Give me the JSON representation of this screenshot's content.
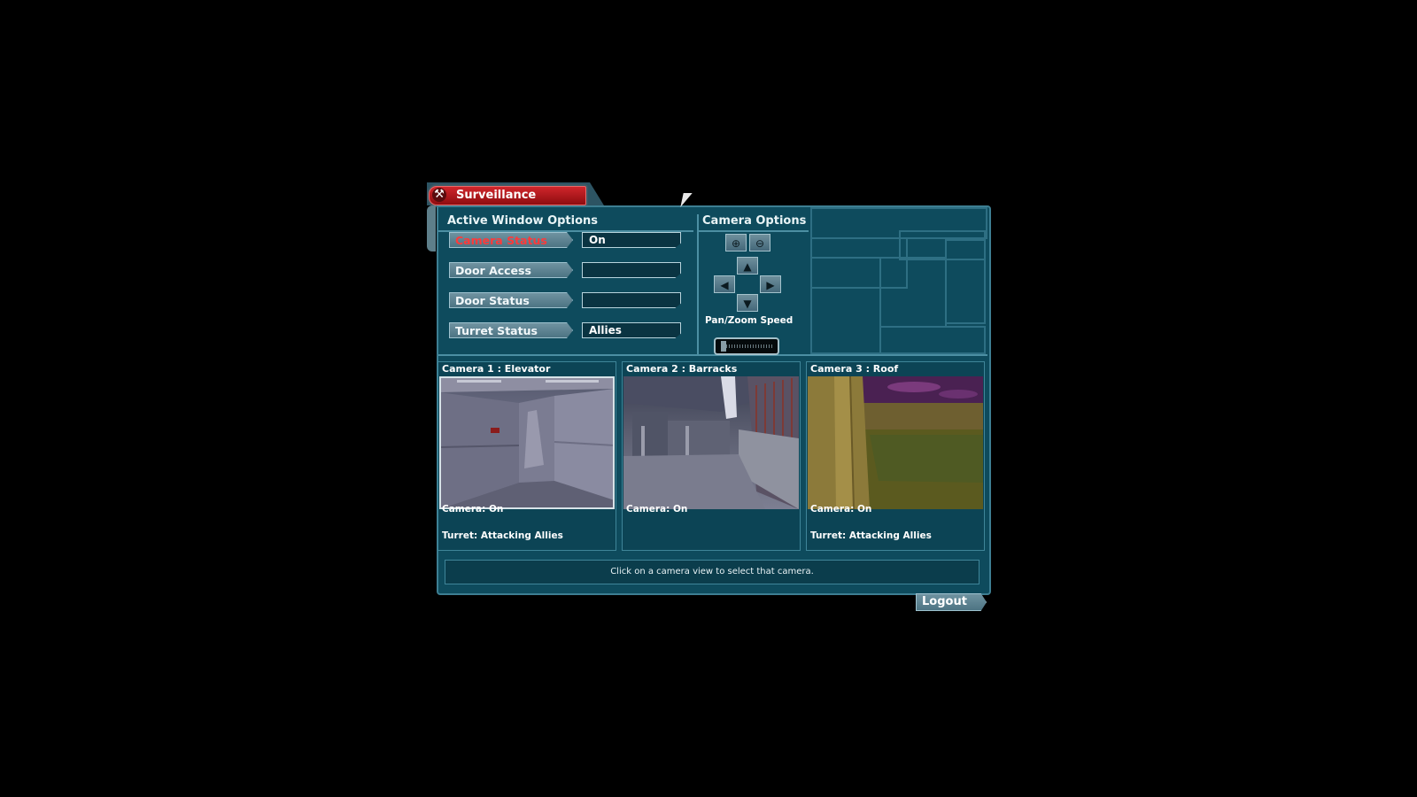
{
  "window": {
    "title": "Surveillance"
  },
  "active_window_options": {
    "header": "Active Window Options",
    "rows": [
      {
        "label": "Camera Status",
        "value": "On",
        "active": true
      },
      {
        "label": "Door Access",
        "value": ""
      },
      {
        "label": "Door Status",
        "value": ""
      },
      {
        "label": "Turret Status",
        "value": "Allies"
      }
    ]
  },
  "camera_options": {
    "header": "Camera Options",
    "zoom_in_icon": "zoom-in-icon",
    "zoom_out_icon": "zoom-out-icon",
    "pan_zoom_label": "Pan/Zoom Speed",
    "pan_zoom_speed": 0.05
  },
  "cameras": [
    {
      "title": "Camera 1 : Elevator",
      "camera_status": "Camera: On",
      "turret_status": "Turret: Attacking Allies",
      "selected": true
    },
    {
      "title": "Camera 2 : Barracks",
      "camera_status": "Camera: On",
      "turret_status": ""
    },
    {
      "title": "Camera 3 : Roof",
      "camera_status": "Camera: On",
      "turret_status": "Turret: Attacking Allies"
    }
  ],
  "status_message": "Click on a camera view to select that camera.",
  "logout_label": "Logout",
  "colors": {
    "panel": "#0e4b5d",
    "active_label": "#ff3a3a",
    "title_tab": "#c81e24"
  }
}
